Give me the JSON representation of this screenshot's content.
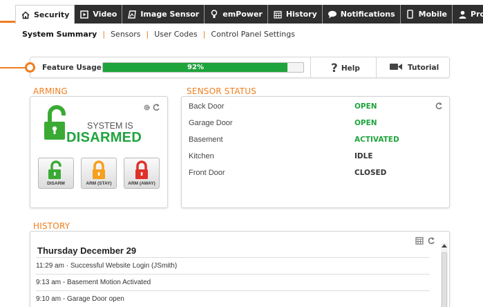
{
  "nav": {
    "tabs": [
      {
        "label": "Security",
        "icon": "home-icon",
        "active": true
      },
      {
        "label": "Video",
        "icon": "video-icon"
      },
      {
        "label": "Image Sensor",
        "icon": "image-sensor-icon"
      },
      {
        "label": "emPower",
        "icon": "lightbulb-icon"
      },
      {
        "label": "History",
        "icon": "calendar-icon"
      },
      {
        "label": "Notifications",
        "icon": "speech-bubble-icon"
      },
      {
        "label": "Mobile",
        "icon": "mobile-icon"
      },
      {
        "label": "Profile",
        "icon": "person-icon"
      }
    ],
    "subnav": [
      "System Summary",
      "Sensors",
      "User Codes",
      "Control Panel Settings"
    ]
  },
  "feature_usage": {
    "label": "Feature Usage",
    "percent_text": "92%",
    "percent_value": 92,
    "help_label": "Help",
    "tutorial_label": "Tutorial"
  },
  "arming": {
    "title": "ARMING",
    "status_line1": "SYSTEM IS",
    "status_line2": "DISARMED",
    "buttons": [
      {
        "label": "DISARM",
        "color": "#3aaa35"
      },
      {
        "label": "ARM (STAY)",
        "color": "#f5a01e"
      },
      {
        "label": "ARM (AWAY)",
        "color": "#e0302a"
      }
    ]
  },
  "sensor_status": {
    "title": "SENSOR STATUS",
    "rows": [
      {
        "name": "Back Door",
        "status": "OPEN",
        "tone": "green"
      },
      {
        "name": "Garage Door",
        "status": "OPEN",
        "tone": "green"
      },
      {
        "name": "Basement",
        "status": "ACTIVATED",
        "tone": "green"
      },
      {
        "name": "Kitchen",
        "status": "IDLE",
        "tone": "dark"
      },
      {
        "name": "Front Door",
        "status": "CLOSED",
        "tone": "dark"
      }
    ]
  },
  "history": {
    "title": "HISTORY",
    "date": "Thursday December 29",
    "entries": [
      "11:29 am · Successful Website Login (JSmith)",
      "9:13 am - Basement Motion Activated",
      "9:10 am - Garage Door open"
    ]
  },
  "colors": {
    "accent": "#f07d1e",
    "success": "#1ea43d",
    "nav_bg": "#2f2f2f"
  }
}
